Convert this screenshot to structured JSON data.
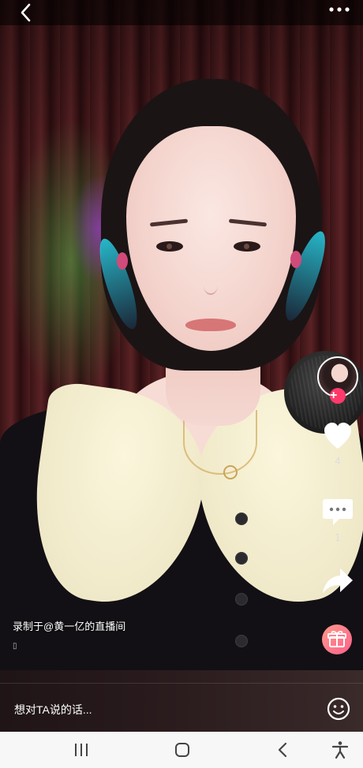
{
  "top_bar": {
    "back_icon": "chevron-left-icon",
    "more_icon": "more-horizontal-icon"
  },
  "right_rail": {
    "avatar_icon": "creator-avatar",
    "follow_icon": "plus-icon",
    "follow_symbol": "+",
    "like_icon": "heart-icon",
    "like_count": "4",
    "comment_icon": "comment-bubble-icon",
    "comment_count": "1",
    "share_icon": "share-arrow-icon",
    "gift_icon": "gift-icon"
  },
  "video": {
    "caption": "录制于@黄一亿的直播间",
    "small_mark": "▯"
  },
  "comment_bar": {
    "placeholder": "想对TA说的话...",
    "emoji_icon": "emoji-icon"
  },
  "nav_bar": {
    "recents_icon": "recents-icon",
    "home_icon": "home-icon",
    "back_icon": "back-icon",
    "accessibility_icon": "accessibility-icon"
  },
  "colors": {
    "accent": "#ff3a6b",
    "gift_gradient_start": "#ff9a8b",
    "gift_gradient_end": "#ff5f8a",
    "nav_bg": "#f7f7f7"
  }
}
